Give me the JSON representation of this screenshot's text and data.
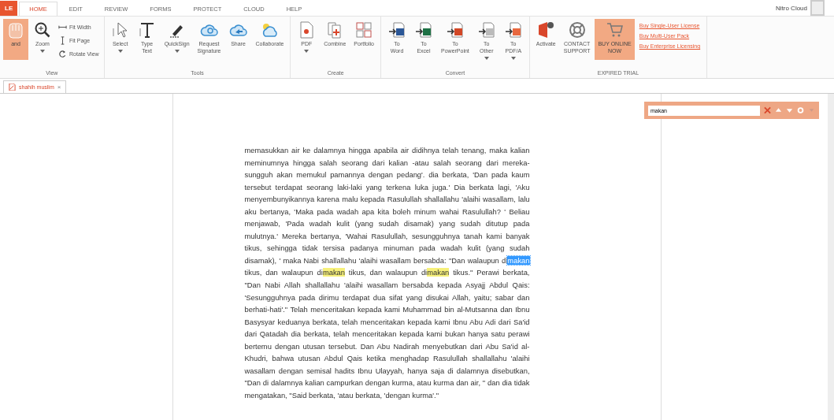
{
  "file_menu": {
    "label": "LE"
  },
  "app_tabs": [
    {
      "label": "HOME",
      "selected": true
    },
    {
      "label": "EDIT",
      "selected": false
    },
    {
      "label": "REVIEW",
      "selected": false
    },
    {
      "label": "FORMS",
      "selected": false
    },
    {
      "label": "PROTECT",
      "selected": false
    },
    {
      "label": "CLOUD",
      "selected": false
    },
    {
      "label": "HELP",
      "selected": false
    }
  ],
  "account": {
    "label": "Nitro Cloud"
  },
  "ribbon": [
    {
      "title": "View",
      "items": [
        {
          "label": "and",
          "kind": "large",
          "selected": true,
          "has_menu": false
        },
        {
          "label": "Zoom",
          "kind": "large",
          "selected": false,
          "has_menu": true
        },
        {
          "label": "Fit Width",
          "kind": "small"
        },
        {
          "label": "Fit Page",
          "kind": "small"
        },
        {
          "label": "Rotate View",
          "kind": "small"
        }
      ]
    },
    {
      "title": "Tools",
      "items": [
        {
          "label": "Select",
          "kind": "large",
          "selected": false,
          "has_menu": true
        },
        {
          "label": "Type\nText",
          "kind": "large",
          "selected": false,
          "has_menu": false
        },
        {
          "label": "QuickSign",
          "kind": "large",
          "selected": false,
          "has_menu": true
        },
        {
          "label": "Request\nSignature",
          "kind": "large",
          "selected": false,
          "has_menu": false
        },
        {
          "label": "Share",
          "kind": "large",
          "selected": false,
          "has_menu": false
        },
        {
          "label": "Collaborate",
          "kind": "large",
          "selected": false,
          "has_menu": false
        }
      ]
    },
    {
      "title": "Create",
      "items": [
        {
          "label": "PDF",
          "kind": "large",
          "selected": false,
          "has_menu": true
        },
        {
          "label": "Combine",
          "kind": "large",
          "selected": false,
          "has_menu": false
        },
        {
          "label": "Portfolio",
          "kind": "large",
          "selected": false,
          "has_menu": false
        }
      ]
    },
    {
      "title": "Convert",
      "items": [
        {
          "label": "To\nWord",
          "kind": "large",
          "selected": false,
          "has_menu": false
        },
        {
          "label": "To\nExcel",
          "kind": "large",
          "selected": false,
          "has_menu": false
        },
        {
          "label": "To\nPowerPoint",
          "kind": "large",
          "selected": false,
          "has_menu": false
        },
        {
          "label": "To\nOther",
          "kind": "large",
          "selected": false,
          "has_menu": true
        },
        {
          "label": "To\nPDF/A",
          "kind": "large",
          "selected": false,
          "has_menu": true
        }
      ]
    },
    {
      "title": "EXPIRED TRIAL",
      "items": [
        {
          "label": "Activate",
          "kind": "large",
          "selected": false,
          "has_menu": false
        },
        {
          "label": "CONTACT\nSUPPORT",
          "kind": "large",
          "selected": false,
          "has_menu": false
        },
        {
          "label": "BUY ONLINE\nNOW",
          "kind": "large",
          "selected": true,
          "has_menu": false
        },
        {
          "label": "Buy Single-User License",
          "kind": "link"
        },
        {
          "label": "Buy Multi-User Pack",
          "kind": "link"
        },
        {
          "label": "Buy Enterprise Licensing",
          "kind": "link"
        }
      ]
    }
  ],
  "document_tab": {
    "label": "shahih muslim",
    "close": "×"
  },
  "find_bar": {
    "value": "makan"
  },
  "page": {
    "segments": [
      {
        "text": "memasukkan air ke dalamnya hingga apabila air didihnya telah tenang, maka kalian meminumnya hingga salah seorang dari kalian -atau salah seorang dari mereka- sungguh akan memukul pamannya dengan pedang'. dia berkata, 'Dan pada kaum tersebut terdapat seorang laki-laki yang terkena luka juga.' Dia berkata lagi, 'Aku menyembunyikannya karena malu kepada Rasulullah shallallahu 'alaihi wasallam, lalu aku bertanya, 'Maka pada wadah apa kita boleh minum wahai Rasulullah? ' Beliau menjawab, 'Pada wadah kulit (yang sudah disamak) yang sudah ditutup pada mulutnya.' Mereka bertanya, 'Wahai Rasulullah, sesungguhnya tanah kami banyak tikus, sehingga tidak tersisa padanya minuman pada wadah kulit (yang sudah disamak), ' maka Nabi shallallahu 'alaihi wasallam bersabda: \"Dan walaupun di",
        "highlighted": false,
        "selected": false
      },
      {
        "text": "makan",
        "highlighted": true,
        "selected": true
      },
      {
        "text": " tikus, dan walaupun di",
        "highlighted": false,
        "selected": false
      },
      {
        "text": "makan",
        "highlighted": true,
        "selected": false
      },
      {
        "text": " tikus, dan walaupun di",
        "highlighted": false,
        "selected": false
      },
      {
        "text": "makan",
        "highlighted": true,
        "selected": false
      },
      {
        "text": " tikus.\" Perawi berkata, \"Dan Nabi Allah shallallahu 'alaihi wasallam bersabda kepada Asyajj Abdul Qais: 'Sesungguhnya pada dirimu terdapat dua sifat yang disukai Allah, yaitu; sabar dan berhati-hati'.\" Telah menceritakan kepada kami Muhammad bin al-Mutsanna dan Ibnu Basysyar keduanya berkata, telah menceritakan kepada kami Ibnu Abu Adi dari Sa'id dari Qatadah dia berkata, telah menceritakan kepada kami bukan hanya satu perawi bertemu dengan utusan tersebut. Dan Abu Nadirah menyebutkan dari Abu Sa'id al-Khudri, bahwa utusan Abdul Qais ketika menghadap Rasulullah shallallahu 'alaihi wasallam dengan semisal hadits Ibnu Ulayyah, hanya saja di dalamnya disebutkan, \"Dan di dalamnya kalian campurkan dengan kurma, atau kurma dan air, \" dan dia tidak mengatakan, \"Said berkata, 'atau berkata, 'dengan kurma'.\"",
        "highlighted": false,
        "selected": false
      }
    ]
  }
}
